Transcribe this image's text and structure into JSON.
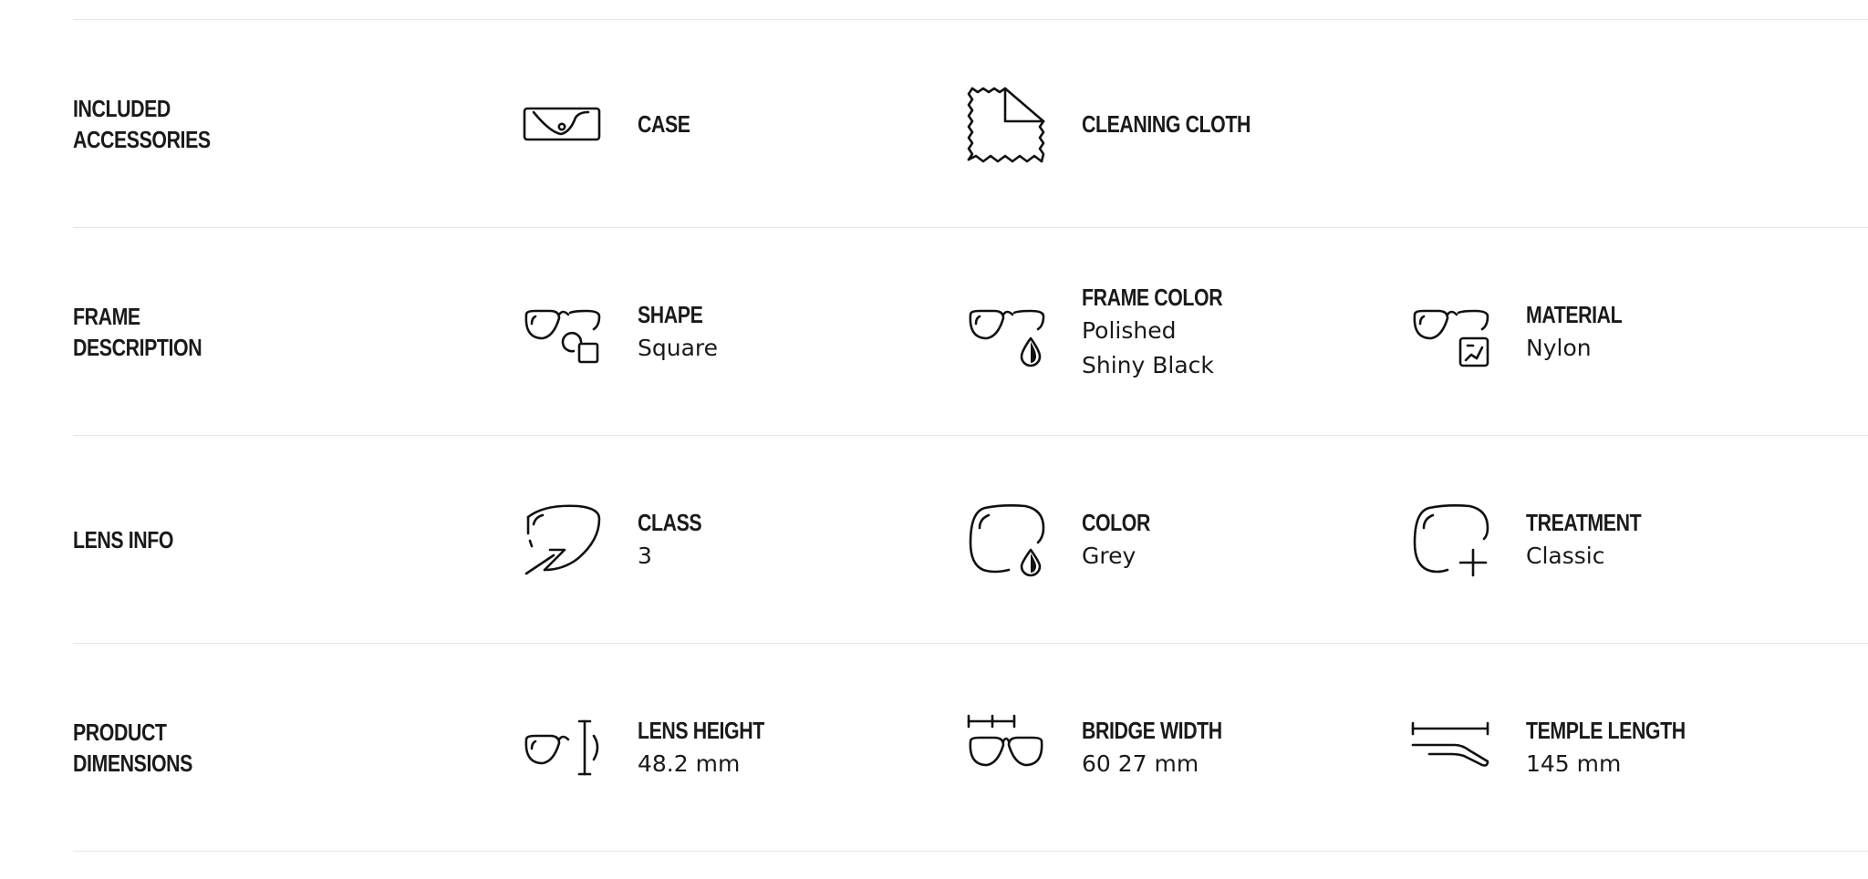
{
  "rows": [
    {
      "title": "INCLUDED\nACCESSORIES",
      "items": [
        {
          "label": "CASE",
          "value": "",
          "icon": "case-icon"
        },
        {
          "label": "CLEANING CLOTH",
          "value": "",
          "icon": "cleaning-cloth-icon"
        }
      ]
    },
    {
      "title": "FRAME\nDESCRIPTION",
      "items": [
        {
          "label": "SHAPE",
          "value": "Square",
          "icon": "frame-shape-icon"
        },
        {
          "label": "FRAME COLOR",
          "value": "Polished Shiny Black",
          "icon": "frame-color-icon"
        },
        {
          "label": "MATERIAL",
          "value": "Nylon",
          "icon": "frame-material-icon"
        }
      ]
    },
    {
      "title": "LENS INFO",
      "items": [
        {
          "label": "CLASS",
          "value": "3",
          "icon": "lens-class-icon"
        },
        {
          "label": "COLOR",
          "value": "Grey",
          "icon": "lens-color-icon"
        },
        {
          "label": "TREATMENT",
          "value": "Classic",
          "icon": "lens-treatment-icon"
        }
      ]
    },
    {
      "title": "PRODUCT\nDIMENSIONS",
      "items": [
        {
          "label": "LENS HEIGHT",
          "value": "48.2 mm",
          "icon": "lens-height-icon"
        },
        {
          "label": "BRIDGE WIDTH",
          "value": "60 27 mm",
          "icon": "bridge-width-icon"
        },
        {
          "label": "TEMPLE LENGTH",
          "value": "145 mm",
          "icon": "temple-length-icon"
        }
      ]
    }
  ]
}
